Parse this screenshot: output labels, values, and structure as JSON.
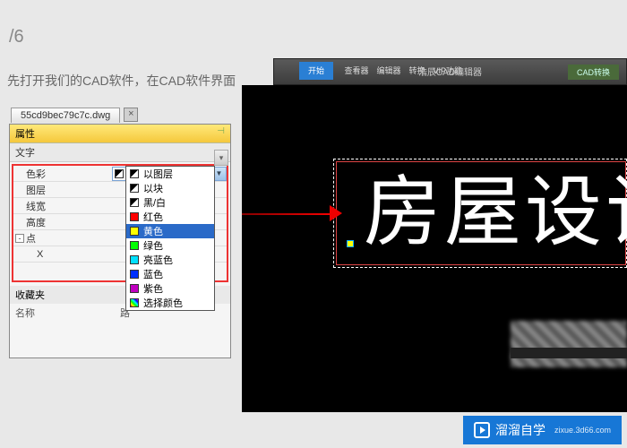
{
  "breadcrumb": "/6",
  "instruction": "先打开我们的CAD软件，在CAD软件界面",
  "ribbon": {
    "mid": "浩辰CAD编辑器",
    "btn": "CAD转换"
  },
  "tab": {
    "name": "55cd9bec79c7c.dwg"
  },
  "panel": {
    "title": "属性",
    "cat_text": "文字",
    "rows": {
      "color": "色彩",
      "layer": "图层",
      "lineweight": "线宽",
      "height": "高度",
      "point": "点",
      "x": "X"
    },
    "combo_value": "黑/白",
    "fav_header": "收藏夹",
    "fav_cols": {
      "name": "名称",
      "path": "路"
    }
  },
  "dropdown": {
    "items": [
      {
        "label": "以图层",
        "swatch": "linear-gradient(135deg,#000 50%,#fff 50%)"
      },
      {
        "label": "以块",
        "swatch": "linear-gradient(135deg,#000 50%,#fff 50%)"
      },
      {
        "label": "黑/白",
        "swatch": "linear-gradient(135deg,#000 50%,#fff 50%)"
      },
      {
        "label": "红色",
        "swatch": "#ff0000"
      },
      {
        "label": "黄色",
        "swatch": "#ffff00",
        "selected": true
      },
      {
        "label": "绿色",
        "swatch": "#00ff00"
      },
      {
        "label": "亮蓝色",
        "swatch": "#00e0ff"
      },
      {
        "label": "蓝色",
        "swatch": "#0030ff"
      },
      {
        "label": "紫色",
        "swatch": "#c000c0"
      },
      {
        "label": "选择颜色",
        "swatch": "linear-gradient(45deg,red,yellow,lime,cyan,blue,magenta)"
      }
    ]
  },
  "canvas_text": "房屋设计",
  "watermark": {
    "brand": "溜溜自学",
    "url": "zixue.3d66.com"
  }
}
